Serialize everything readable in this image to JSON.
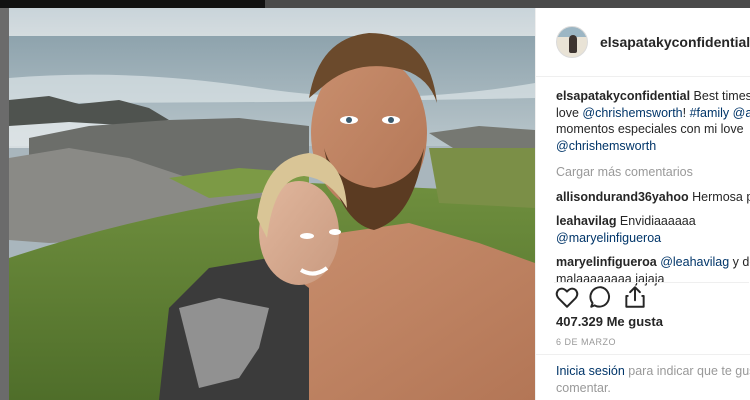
{
  "post": {
    "username": "elsapatakyconfidential",
    "verified_glyph": "✔",
    "more_dot": "•",
    "caption": {
      "username": "elsapatakyconfidential",
      "line1_text": " Best times w",
      "line2_prefix": "love ",
      "line2_mention": "@chrishemsworth",
      "line2_middle": "! ",
      "line2_hashtag": "#family",
      "line2_space": " ",
      "line2_mention2": "@a",
      "line3_text": "momentos especiales con mi love",
      "line4_mention": "@chrishemsworth"
    },
    "load_more": "Cargar más comentarios",
    "comments": [
      {
        "user": "allisondurand36yahoo",
        "text": " Hermosa par"
      },
      {
        "user": "leahavilag",
        "text": " Envidiaaaaaa",
        "line2_mention": "@maryelinfigueroa"
      },
      {
        "user": "maryelinfigueroa",
        "mention": " @leahavilag",
        "text": " y de l",
        "line2": "malaaaaaaaa jajaja"
      }
    ],
    "icons": [
      "heart-icon",
      "comment-icon",
      "share-icon"
    ],
    "likes": "407.329 Me gusta",
    "date": "6 DE MARZO",
    "login": {
      "link": "Inicia sesión",
      "text": " para indicar que te gust",
      "line2": "comentar."
    }
  },
  "colors": {
    "link": "#003569",
    "verified": "#3897f0",
    "muted": "#999999",
    "text": "#262626"
  }
}
